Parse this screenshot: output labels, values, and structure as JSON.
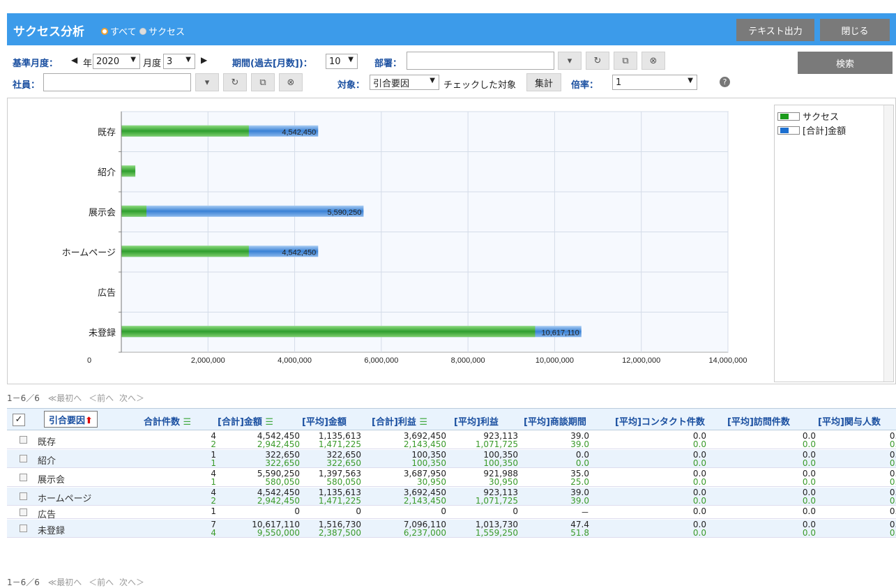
{
  "title": "サクセス分析",
  "radio": [
    {
      "label": "すべて",
      "checked": true
    },
    {
      "label": "サクセス",
      "checked": false
    }
  ],
  "buttons": {
    "text_output": "テキスト出力",
    "close": "閉じる",
    "search": "検索",
    "aggregate": "集計"
  },
  "filters": {
    "base_month_label": "基準月度：",
    "year_suffix": "年",
    "year": "2020",
    "month_suffix": "月度",
    "month": "3",
    "period_label": "期間(過去[月数])：",
    "period": "10",
    "dept_label": "部署：",
    "dept_value": "",
    "employee_label": "社員：",
    "employee_value": "",
    "target_label": "対象：",
    "target": "引合要因",
    "checked_target": "チェックした対象",
    "rate_label": "倍率：",
    "rate": "1"
  },
  "legend": [
    {
      "label": "サクセス",
      "color": "#1a9a1a"
    },
    {
      "label": "[合計]金額",
      "color": "#1c6fd0"
    }
  ],
  "chart_data": {
    "type": "bar",
    "orientation": "horizontal",
    "categories": [
      "既存",
      "紹介",
      "展示会",
      "ホームページ",
      "広告",
      "未登録"
    ],
    "series": [
      {
        "name": "サクセス",
        "values": [
          2942450,
          322650,
          580050,
          2942450,
          0,
          9550000
        ],
        "color": "#3aaa3a"
      },
      {
        "name": "[合計]金額",
        "values": [
          4542450,
          322650,
          5590250,
          4542450,
          0,
          10617110
        ],
        "color": "#3a86d8"
      }
    ],
    "data_labels": [
      "4,542,450",
      "",
      "5,590,250",
      "4,542,450",
      "",
      "10,617,110"
    ],
    "x_ticks": [
      "0",
      "2,000,000",
      "4,000,000",
      "6,000,000",
      "8,000,000",
      "10,000,000",
      "12,000,000",
      "14,000,000"
    ],
    "xlim": [
      0,
      14000000
    ],
    "grid": true,
    "legend_position": "right"
  },
  "pager": {
    "range": "1－6／6",
    "first": "≪最初へ",
    "prev": "＜前へ",
    "next": "次へ＞"
  },
  "table": {
    "headers": [
      "引合要因",
      "合計件数",
      "[合計]金額",
      "[平均]金額",
      "[合計]利益",
      "[平均]利益",
      "[平均]商談期間",
      "[平均]コンタクト件数",
      "[平均]訪問件数",
      "[平均]関与人数"
    ],
    "rows": [
      {
        "name": "既存",
        "top": [
          "4",
          "4,542,450",
          "1,135,613",
          "3,692,450",
          "923,113",
          "39.0",
          "0.0",
          "0.0",
          "0.0"
        ],
        "bottom": [
          "2",
          "2,942,450",
          "1,471,225",
          "2,143,450",
          "1,071,725",
          "39.0",
          "0.0",
          "0.0",
          "0.0"
        ]
      },
      {
        "name": "紹介",
        "top": [
          "1",
          "322,650",
          "322,650",
          "100,350",
          "100,350",
          "0.0",
          "0.0",
          "0.0",
          "0.0"
        ],
        "bottom": [
          "1",
          "322,650",
          "322,650",
          "100,350",
          "100,350",
          "0.0",
          "0.0",
          "0.0",
          "0.0"
        ]
      },
      {
        "name": "展示会",
        "top": [
          "4",
          "5,590,250",
          "1,397,563",
          "3,687,950",
          "921,988",
          "35.0",
          "0.0",
          "0.0",
          "0.0"
        ],
        "bottom": [
          "1",
          "580,050",
          "580,050",
          "30,950",
          "30,950",
          "25.0",
          "0.0",
          "0.0",
          "0.0"
        ]
      },
      {
        "name": "ホームページ",
        "top": [
          "4",
          "4,542,450",
          "1,135,613",
          "3,692,450",
          "923,113",
          "39.0",
          "0.0",
          "0.0",
          "0.0"
        ],
        "bottom": [
          "2",
          "2,942,450",
          "1,471,225",
          "2,143,450",
          "1,071,725",
          "39.0",
          "0.0",
          "0.0",
          "0.0"
        ]
      },
      {
        "name": "広告",
        "top": [
          "1",
          "0",
          "0",
          "0",
          "0",
          "－",
          "0.0",
          "0.0",
          "0.0"
        ],
        "bottom": null
      },
      {
        "name": "未登録",
        "top": [
          "7",
          "10,617,110",
          "1,516,730",
          "7,096,110",
          "1,013,730",
          "47.4",
          "0.0",
          "0.0",
          "0.0"
        ],
        "bottom": [
          "4",
          "9,550,000",
          "2,387,500",
          "6,237,000",
          "1,559,250",
          "51.8",
          "0.0",
          "0.0",
          "0.0"
        ]
      }
    ]
  }
}
